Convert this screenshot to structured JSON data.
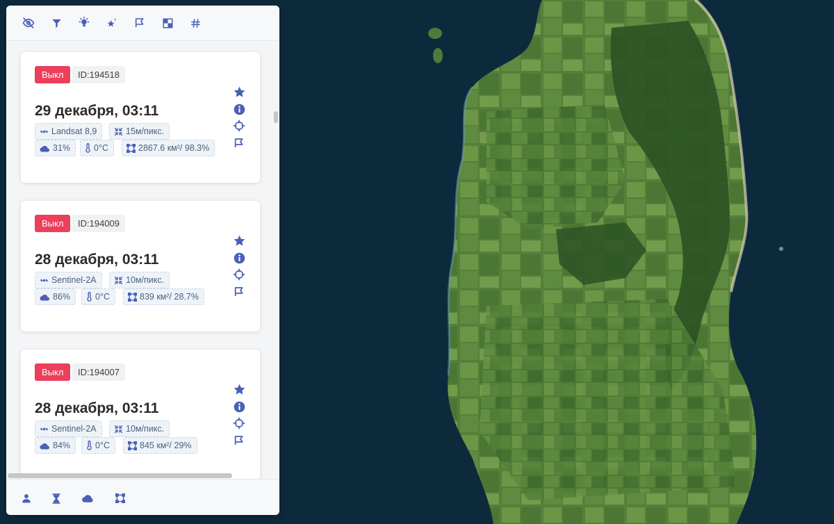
{
  "colors": {
    "accent": "#4a5fb5",
    "badge_off": "#ec3f5c",
    "sea": "#0d2a3d",
    "land": "#3f6a2d"
  },
  "toolbar": {
    "icons": [
      "eye-off-icon",
      "filter-icon",
      "lightbulb-icon",
      "star-sparkle-icon",
      "flag-area-icon",
      "checker-icon",
      "hash-icon"
    ]
  },
  "cards": [
    {
      "status": "Выкл",
      "id": "ID:194518",
      "date": "29 декабря, 03:11",
      "satellite": "Landsat 8,9",
      "resolution": "15м/пикс.",
      "clouds": "31%",
      "temperature": "0°C",
      "area": "2867.6 км²/ 98.3%"
    },
    {
      "status": "Выкл",
      "id": "ID:194009",
      "date": "28 декабря, 03:11",
      "satellite": "Sentinel-2A",
      "resolution": "10м/пикс.",
      "clouds": "86%",
      "temperature": "0°C",
      "area": "839 км²/ 28.7%"
    },
    {
      "status": "Выкл",
      "id": "ID:194007",
      "date": "28 декабря, 03:11",
      "satellite": "Sentinel-2A",
      "resolution": "10м/пикс.",
      "clouds": "84%",
      "temperature": "0°C",
      "area": "845 км²/ 29%"
    }
  ],
  "card_actions": [
    "star-icon",
    "info-icon",
    "crosshair-icon",
    "flag-icon"
  ],
  "footer": {
    "icons": [
      "user-icon",
      "hourglass-icon",
      "clouds-icon",
      "area-select-icon"
    ]
  }
}
